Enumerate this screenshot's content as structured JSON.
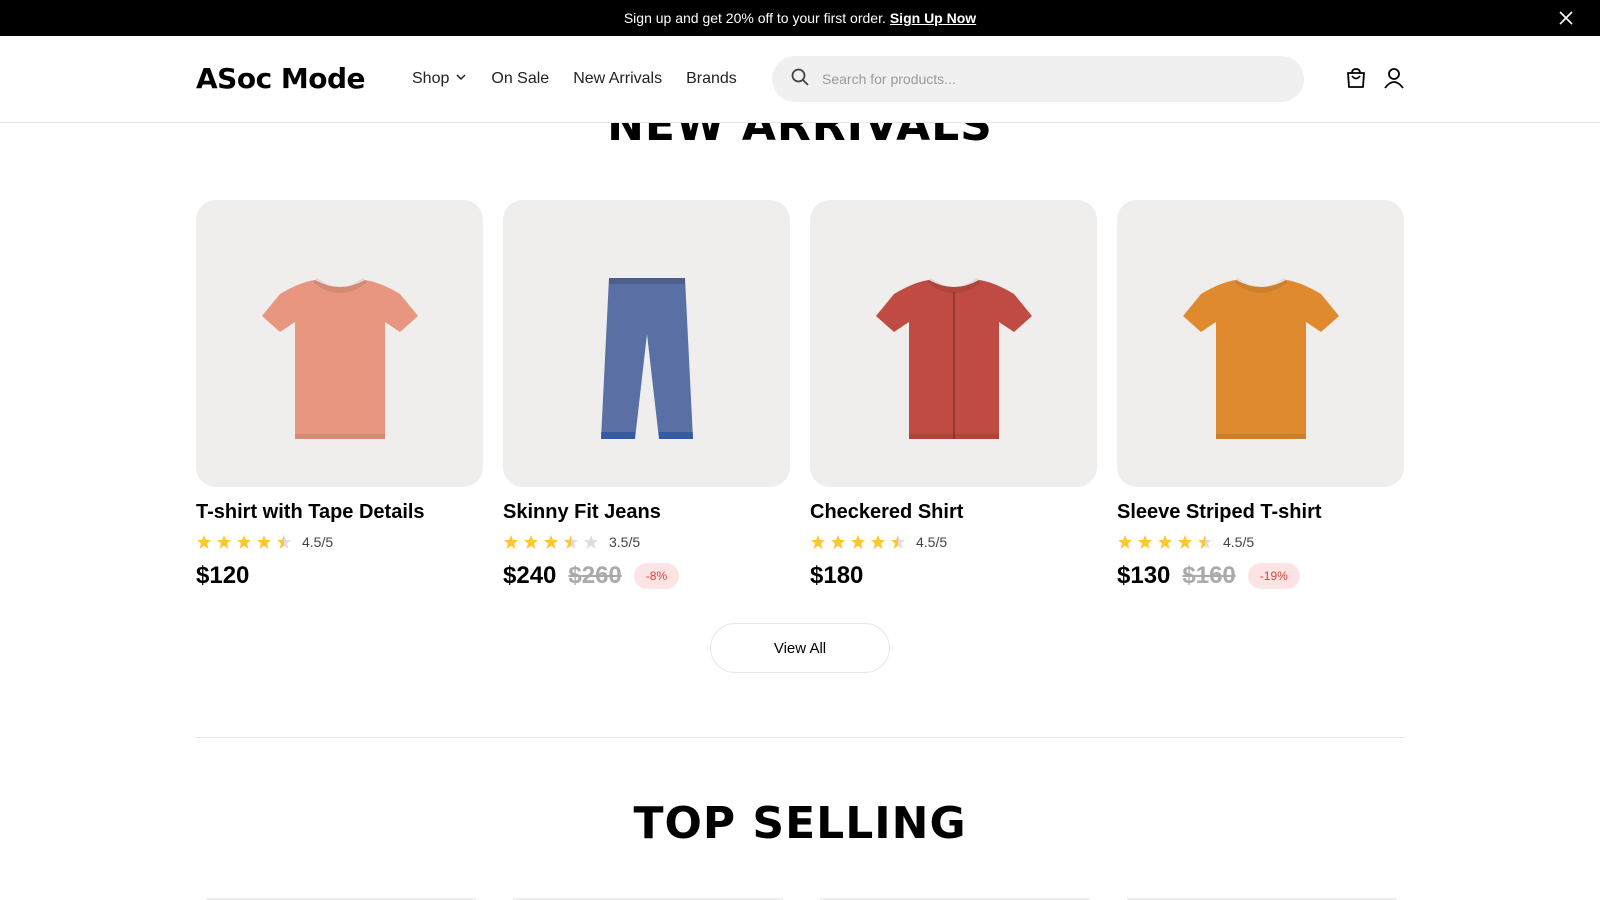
{
  "promo": {
    "text": "Sign up and get 20% off to your first order.",
    "link": "Sign Up Now"
  },
  "nav": {
    "logo": "ASoc Mode",
    "menu": [
      "Shop",
      "On Sale",
      "New Arrivals",
      "Brands"
    ],
    "search_placeholder": "Search for products..."
  },
  "sections": {
    "new_arrivals_title": "NEW ARRIVALS",
    "top_selling_title": "TOP SELLING"
  },
  "products": [
    {
      "name": "T-shirt with Tape Details",
      "rating": 4.5,
      "rating_label": "4.5/5",
      "price": "$120",
      "old_price": "",
      "discount": "",
      "color": "#e8967f",
      "type": "tshirt"
    },
    {
      "name": "Skinny Fit Jeans",
      "rating": 3.5,
      "rating_label": "3.5/5",
      "price": "$240",
      "old_price": "$260",
      "discount": "-8%",
      "color": "#5a6fa3",
      "type": "jeans"
    },
    {
      "name": "Checkered Shirt",
      "rating": 4.5,
      "rating_label": "4.5/5",
      "price": "$180",
      "old_price": "",
      "discount": "",
      "color": "#c04b42",
      "type": "shirt"
    },
    {
      "name": "Sleeve Striped T-shirt",
      "rating": 4.5,
      "rating_label": "4.5/5",
      "price": "$130",
      "old_price": "$160",
      "discount": "-19%",
      "color": "#e08a30",
      "type": "tshirt"
    }
  ],
  "view_all": "View All",
  "colors": {
    "star": "#ffc633",
    "discount_text": "#e0403c",
    "card_bg": "#f0eeed"
  }
}
